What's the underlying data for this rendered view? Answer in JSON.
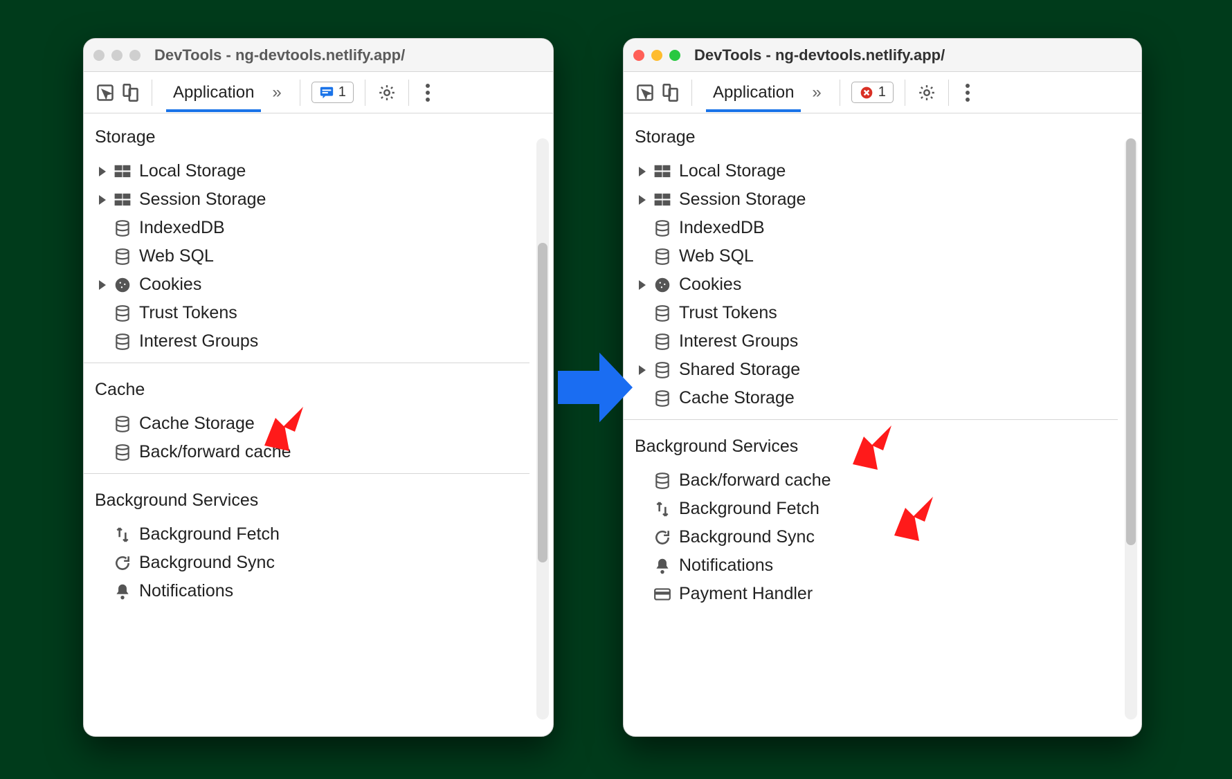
{
  "left": {
    "active": false,
    "title": "DevTools - ng-devtools.netlify.app/",
    "tab": "Application",
    "chev": "»",
    "badge_count": "1",
    "sections": [
      {
        "title": "Storage",
        "items": [
          {
            "label": "Local Storage",
            "icon": "table",
            "expandable": true
          },
          {
            "label": "Session Storage",
            "icon": "table",
            "expandable": true
          },
          {
            "label": "IndexedDB",
            "icon": "db",
            "expandable": false
          },
          {
            "label": "Web SQL",
            "icon": "db",
            "expandable": false
          },
          {
            "label": "Cookies",
            "icon": "cookie",
            "expandable": true
          },
          {
            "label": "Trust Tokens",
            "icon": "db",
            "expandable": false
          },
          {
            "label": "Interest Groups",
            "icon": "db",
            "expandable": false
          }
        ]
      },
      {
        "title": "Cache",
        "items": [
          {
            "label": "Cache Storage",
            "icon": "db",
            "expandable": false
          },
          {
            "label": "Back/forward cache",
            "icon": "db",
            "expandable": false
          }
        ]
      },
      {
        "title": "Background Services",
        "items": [
          {
            "label": "Background Fetch",
            "icon": "fetch",
            "expandable": false
          },
          {
            "label": "Background Sync",
            "icon": "sync",
            "expandable": false
          },
          {
            "label": "Notifications",
            "icon": "bell",
            "expandable": false
          }
        ]
      }
    ]
  },
  "right": {
    "active": true,
    "title": "DevTools - ng-devtools.netlify.app/",
    "tab": "Application",
    "chev": "»",
    "badge_count": "1",
    "sections": [
      {
        "title": "Storage",
        "items": [
          {
            "label": "Local Storage",
            "icon": "table",
            "expandable": true
          },
          {
            "label": "Session Storage",
            "icon": "table",
            "expandable": true
          },
          {
            "label": "IndexedDB",
            "icon": "db",
            "expandable": false
          },
          {
            "label": "Web SQL",
            "icon": "db",
            "expandable": false
          },
          {
            "label": "Cookies",
            "icon": "cookie",
            "expandable": true
          },
          {
            "label": "Trust Tokens",
            "icon": "db",
            "expandable": false
          },
          {
            "label": "Interest Groups",
            "icon": "db",
            "expandable": false
          },
          {
            "label": "Shared Storage",
            "icon": "db",
            "expandable": true
          },
          {
            "label": "Cache Storage",
            "icon": "db",
            "expandable": false
          }
        ]
      },
      {
        "title": "Background Services",
        "items": [
          {
            "label": "Back/forward cache",
            "icon": "db",
            "expandable": false
          },
          {
            "label": "Background Fetch",
            "icon": "fetch",
            "expandable": false
          },
          {
            "label": "Background Sync",
            "icon": "sync",
            "expandable": false
          },
          {
            "label": "Notifications",
            "icon": "bell",
            "expandable": false
          },
          {
            "label": "Payment Handler",
            "icon": "card",
            "expandable": false
          }
        ]
      }
    ]
  },
  "colors": {
    "accent": "#1a73e8",
    "arrow_blue": "#1a6df2",
    "arrow_red": "#ff1a1a"
  }
}
